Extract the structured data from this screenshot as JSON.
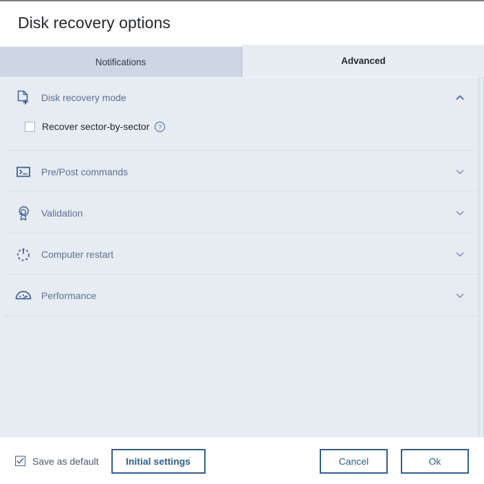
{
  "window": {
    "title": "Disk recovery options"
  },
  "tabs": [
    {
      "label": "Notifications",
      "active": false,
      "name": "tab-notifications"
    },
    {
      "label": "Advanced",
      "active": true,
      "name": "tab-advanced"
    }
  ],
  "sections": [
    {
      "label": "Disk recovery mode",
      "icon": "document-add-icon",
      "expanded": true,
      "chevron": "chevron-up-icon",
      "options": [
        {
          "label": "Recover sector-by-sector",
          "checked": false,
          "help": "help-icon"
        }
      ]
    },
    {
      "label": "Pre/Post commands",
      "icon": "console-icon",
      "expanded": false,
      "chevron": "chevron-down-icon",
      "options": []
    },
    {
      "label": "Validation",
      "icon": "award-ribbon-icon",
      "expanded": false,
      "chevron": "chevron-down-icon",
      "options": []
    },
    {
      "label": "Computer restart",
      "icon": "power-restart-icon",
      "expanded": false,
      "chevron": "chevron-down-icon",
      "options": []
    },
    {
      "label": "Performance",
      "icon": "speedometer-icon",
      "expanded": false,
      "chevron": "chevron-down-icon",
      "options": []
    }
  ],
  "footer": {
    "save_as_default_label": "Save as default",
    "save_as_default_checked": true,
    "initial_settings_label": "Initial settings",
    "cancel_label": "Cancel",
    "ok_label": "Ok"
  },
  "colors": {
    "accent": "#2f5d8a",
    "icon_blue": "#42669c",
    "section_label": "#5d7194",
    "body_bg": "#e7ebf2",
    "tab_inactive_bg": "#ccd6e4",
    "tab_active_bg": "#e8ecf3"
  }
}
